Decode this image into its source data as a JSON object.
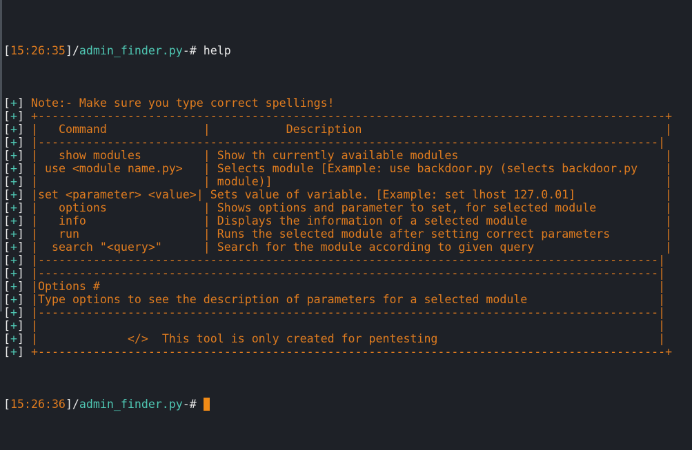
{
  "colors": {
    "background": "#1e2127",
    "foreground": "#e8e8e8",
    "accent_orange": "#e07c1f",
    "accent_teal": "#4fc7b3",
    "cursor": "#f08a16"
  },
  "prompt1": {
    "open": "[",
    "time": "15:26:35",
    "close": "]/",
    "path": "admin_finder.py",
    "sep": "-# ",
    "command": "help"
  },
  "marker": {
    "open": "[",
    "plus": "+",
    "close": "]"
  },
  "lines": [
    "Note:- Make sure you type correct spellings!",
    "+-------------------------------------------------------------------------------------------+",
    "|   Command              |           Description                                            |",
    "|------------------------------------------------------------------------------------------|",
    "|   show modules         | Show th currently available modules                              |",
    "| use <module name.py>   | Selects module [Example: use backdoor.py (selects backdoor.py    |",
    "|                        | module)]                                                         |",
    "|set <parameter> <value>| Sets value of variable. [Example: set lhost 127.0.01]             |",
    "|   options              | Shows options and parameter to set, for selected module          |",
    "|   info                 | Displays the information of a selected module                    |",
    "|   run                  | Runs the selected module after setting correct parameters        |",
    "|  search \"<query>\"      | Search for the module according to given query                   |",
    "|------------------------------------------------------------------------------------------|",
    "|------------------------------------------------------------------------------------------|",
    "|Options #                                                                                 |",
    "|Type options to see the description of parameters for a selected module                   |",
    "|------------------------------------------------------------------------------------------|",
    "|                                                                                          |",
    "|             </>  This tool is only created for pentesting                                |",
    "+-------------------------------------------------------------------------------------------+"
  ],
  "prompt2": {
    "open": "[",
    "time": "15:26:36",
    "close": "]/",
    "path": "admin_finder.py",
    "sep": "-# "
  }
}
